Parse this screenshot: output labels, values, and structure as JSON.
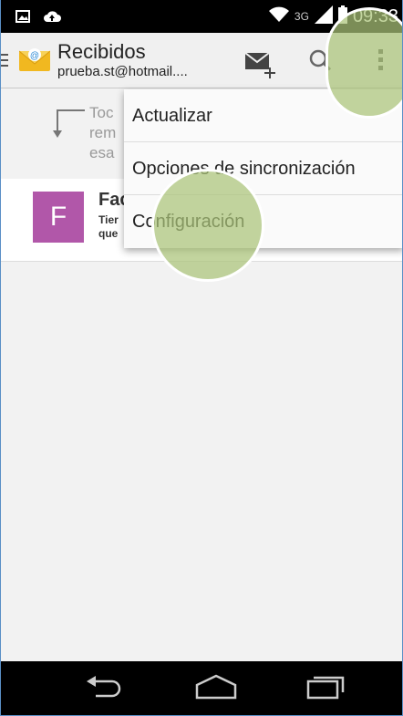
{
  "status_bar": {
    "time": "09:33",
    "network": "3G",
    "icons": [
      "image-icon",
      "cloud-upload-icon",
      "wifi-icon",
      "signal-icon",
      "battery-icon"
    ]
  },
  "action_bar": {
    "title": "Recibidos",
    "account": "prueba.st@hotmail....",
    "icons": [
      "menu-icon",
      "email-app-icon",
      "compose-icon",
      "search-icon",
      "overflow-menu-icon"
    ]
  },
  "hint": {
    "lines": [
      "Toc",
      "rem",
      "esa"
    ]
  },
  "message": {
    "avatar_letter": "F",
    "sender": "Fac",
    "line1": "Tier",
    "line2": "que"
  },
  "menu": {
    "items": [
      {
        "label": "Actualizar"
      },
      {
        "label": "Opciones de sincronización"
      },
      {
        "label": "Configuración"
      }
    ]
  },
  "colors": {
    "avatar": "#b157a9",
    "touch_highlight": "#aac478",
    "status_bar": "#000000",
    "action_bar": "#f0f0f0"
  },
  "nav_bar": {
    "icons": [
      "back-icon",
      "home-icon",
      "recent-apps-icon"
    ]
  }
}
